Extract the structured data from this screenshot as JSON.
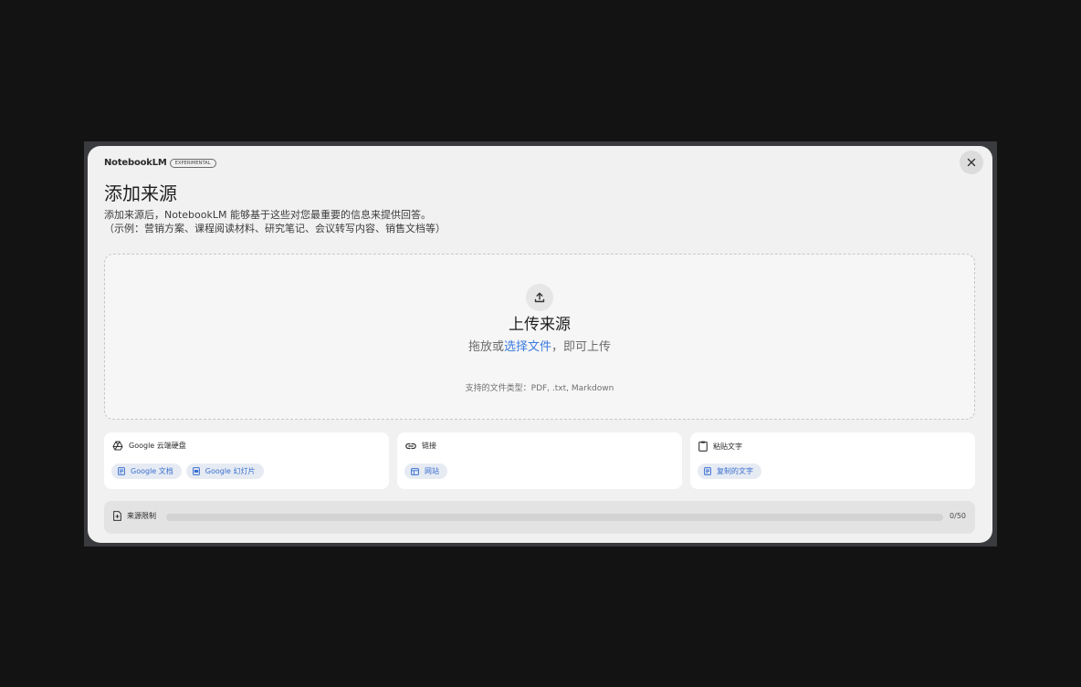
{
  "header": {
    "brand": "NotebookLM",
    "badge": "EXPERIMENTAL",
    "close_icon": "close-icon"
  },
  "dialog": {
    "title": "添加来源",
    "description_line1": "添加来源后，NotebookLM 能够基于这些对您最重要的信息来提供回答。",
    "description_line2": "（示例：营销方案、课程阅读材料、研究笔记、会议转写内容、销售文档等）"
  },
  "upload": {
    "icon": "upload-icon",
    "title": "上传来源",
    "sub_prefix": "拖放或",
    "sub_link": "选择文件",
    "sub_suffix": "，即可上传",
    "file_types": "支持的文件类型：PDF, .txt, Markdown"
  },
  "sources": [
    {
      "title": "Google 云端硬盘",
      "icon": "drive-icon",
      "chips": [
        {
          "label": "Google 文档",
          "icon": "docs-icon"
        },
        {
          "label": "Google 幻灯片",
          "icon": "slides-icon"
        }
      ]
    },
    {
      "title": "链接",
      "icon": "link-icon",
      "chips": [
        {
          "label": "网站",
          "icon": "website-icon"
        }
      ]
    },
    {
      "title": "粘贴文字",
      "icon": "clipboard-icon",
      "chips": [
        {
          "label": "复制的文字",
          "icon": "text-icon"
        }
      ]
    }
  ],
  "limit": {
    "label": "来源限制",
    "icon": "source-limit-icon",
    "count": "0/50",
    "progress_fraction": 0
  },
  "colors": {
    "accent": "#3a7be0",
    "chip_bg": "#e6ebf3",
    "dialog_bg": "#f1f1f1"
  }
}
